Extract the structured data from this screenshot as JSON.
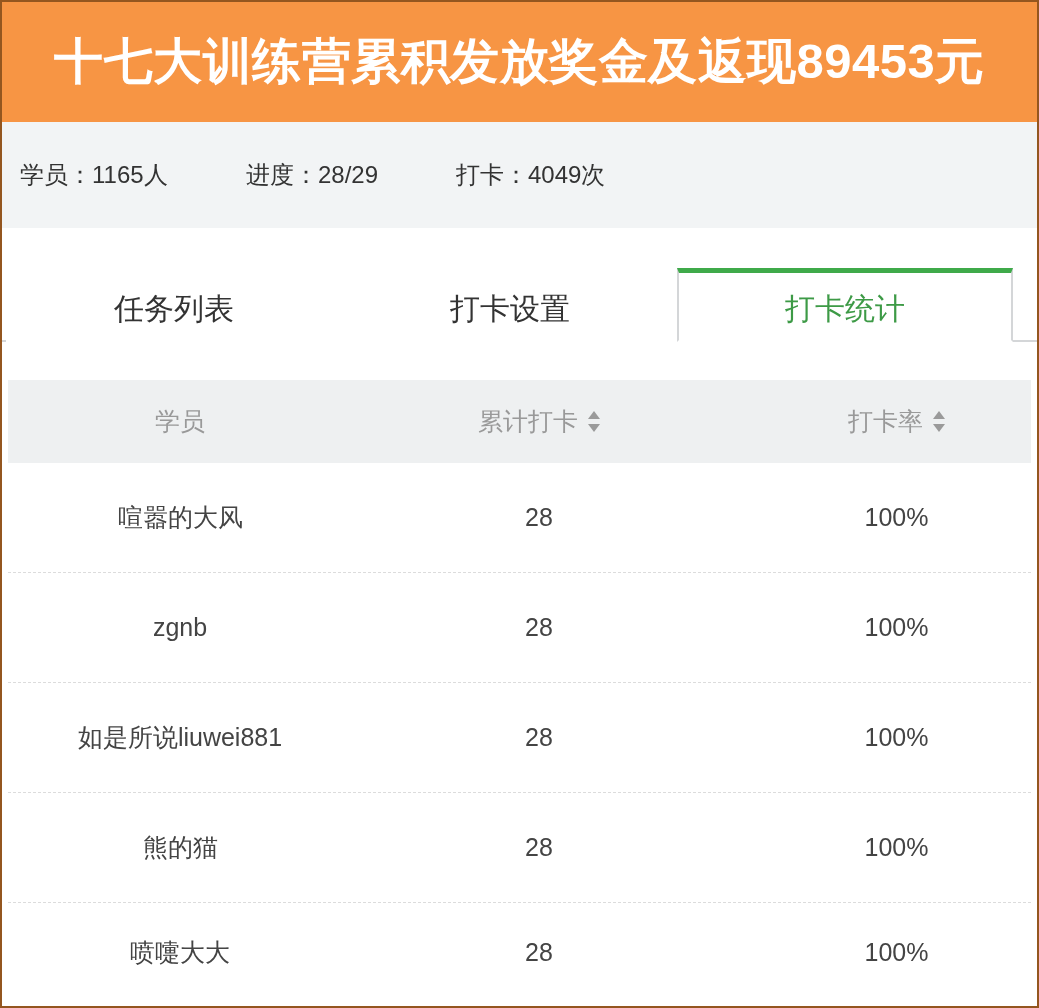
{
  "banner": {
    "title": "十七大训练营累积发放奖金及返现89453元"
  },
  "stats": [
    "学员：1165人",
    "进度：28/29",
    "打卡：4049次"
  ],
  "tabs": [
    {
      "label": "任务列表",
      "selected": false
    },
    {
      "label": "打卡设置",
      "selected": false
    },
    {
      "label": "打卡统计",
      "selected": true
    }
  ],
  "table": {
    "columns": [
      {
        "label": "学员",
        "sortable": false
      },
      {
        "label": "累计打卡",
        "sortable": true
      },
      {
        "label": "打卡率",
        "sortable": true
      }
    ],
    "rows": [
      [
        "喧嚣的大风",
        "28",
        "100%"
      ],
      [
        "zgnb",
        "28",
        "100%"
      ],
      [
        "如是所说liuwei881",
        "28",
        "100%"
      ],
      [
        "熊的猫",
        "28",
        "100%"
      ],
      [
        "喷嚏大大",
        "28",
        "100%"
      ]
    ]
  }
}
